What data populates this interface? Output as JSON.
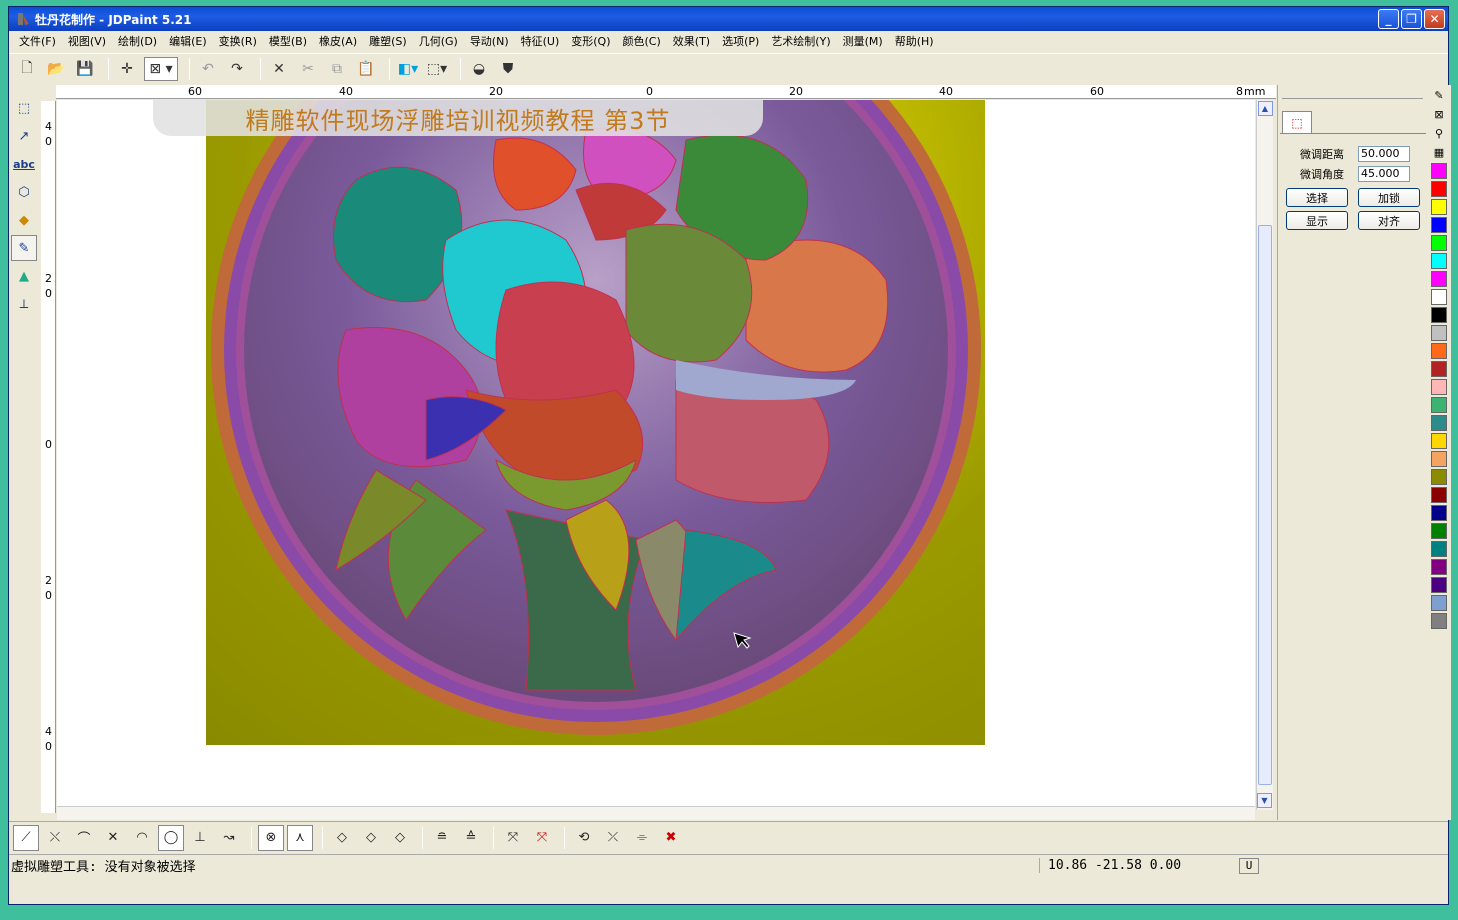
{
  "window": {
    "title": "牡丹花制作 - JDPaint 5.21"
  },
  "menu": [
    "文件(F)",
    "视图(V)",
    "绘制(D)",
    "编辑(E)",
    "变换(R)",
    "模型(B)",
    "橡皮(A)",
    "雕塑(S)",
    "几何(G)",
    "导动(N)",
    "特征(U)",
    "变形(Q)",
    "颜色(C)",
    "效果(T)",
    "选项(P)",
    "艺术绘制(Y)",
    "测量(M)",
    "帮助(H)"
  ],
  "ruler": {
    "top_labels": [
      "60",
      "40",
      "20",
      "0",
      "20",
      "40",
      "60",
      "8",
      "mm"
    ],
    "left_labels": [
      "4",
      "0",
      "2",
      "0",
      "0",
      "2",
      "0",
      "4",
      "0"
    ]
  },
  "banner": {
    "text": "精雕软件现场浮雕培训视频教程    第3节"
  },
  "panel": {
    "fine_distance_label": "微调距离",
    "fine_distance_value": "50.000",
    "fine_angle_label": "微调角度",
    "fine_angle_value": "45.000",
    "buttons": [
      "选择",
      "加锁",
      "显示",
      "对齐"
    ]
  },
  "palette": [
    "#ff00ff",
    "#ff0000",
    "#ffff00",
    "#0000ff",
    "#00ff00",
    "#00ffff",
    "#ff00ff",
    "#ffffff",
    "#000000",
    "#c0c0c0",
    "#ff6a1a",
    "#b22222",
    "#ffb6b6",
    "#3cb371",
    "#2e8b8b",
    "#ffd700",
    "#f4a460",
    "#8b8b00",
    "#8b0000",
    "#00008b",
    "#008000",
    "#008080",
    "#800080",
    "#4b0082",
    "#7f9fd0",
    "#808080"
  ],
  "status": {
    "message": "虚拟雕塑工具: 没有对象被选择",
    "coords": "10.86 -21.58 0.00",
    "u": "U"
  }
}
